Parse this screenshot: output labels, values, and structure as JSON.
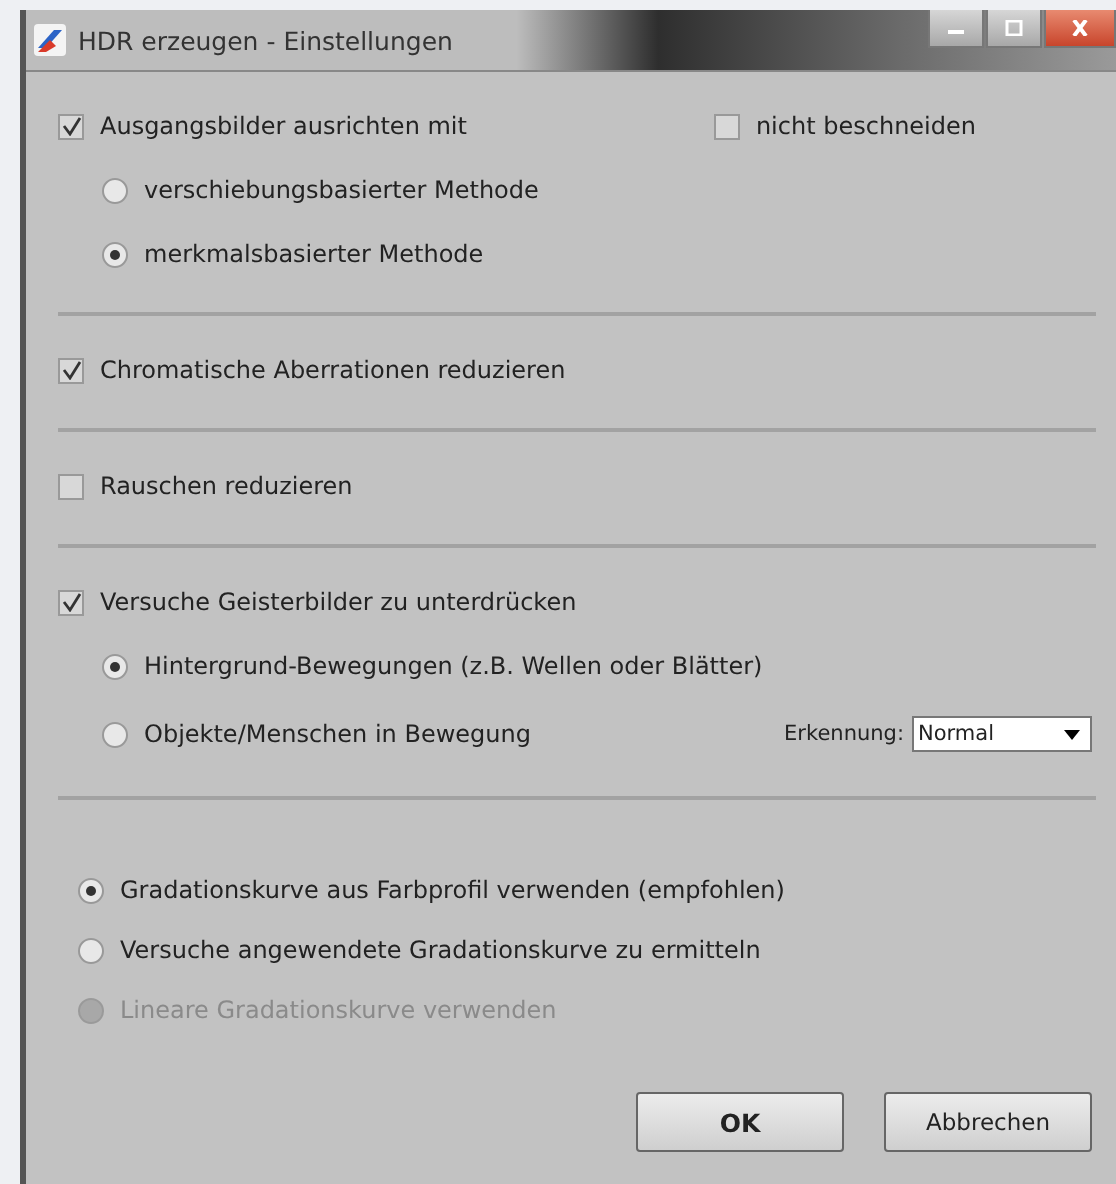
{
  "window": {
    "title": "HDR erzeugen - Einstellungen"
  },
  "alignment": {
    "label": "Ausgangsbilder ausrichten mit",
    "checked": true,
    "no_crop": {
      "label": "nicht beschneiden",
      "checked": false
    },
    "methods": [
      {
        "label": "verschiebungsbasierter Methode",
        "selected": false
      },
      {
        "label": "merkmalsbasierter Methode",
        "selected": true
      }
    ]
  },
  "chromatic": {
    "label": "Chromatische Aberrationen reduzieren",
    "checked": true
  },
  "noise": {
    "label": "Rauschen reduzieren",
    "checked": false
  },
  "ghosts": {
    "label": "Versuche Geisterbilder zu unterdrücken",
    "checked": true,
    "options": [
      {
        "label": "Hintergrund-Bewegungen (z.B. Wellen oder Blätter)",
        "selected": true
      },
      {
        "label": "Objekte/Menschen in Bewegung",
        "selected": false
      }
    ],
    "detection": {
      "label": "Erkennung:",
      "value": "Normal"
    }
  },
  "tone_curve": [
    {
      "label": "Gradationskurve aus Farbprofil verwenden (empfohlen)",
      "selected": true,
      "disabled": false
    },
    {
      "label": "Versuche angewendete Gradationskurve zu ermitteln",
      "selected": false,
      "disabled": false
    },
    {
      "label": "Lineare Gradationskurve verwenden",
      "selected": false,
      "disabled": true
    }
  ],
  "buttons": [
    {
      "label": "OK",
      "default": true
    },
    {
      "label": "Abbrechen",
      "default": false
    }
  ]
}
